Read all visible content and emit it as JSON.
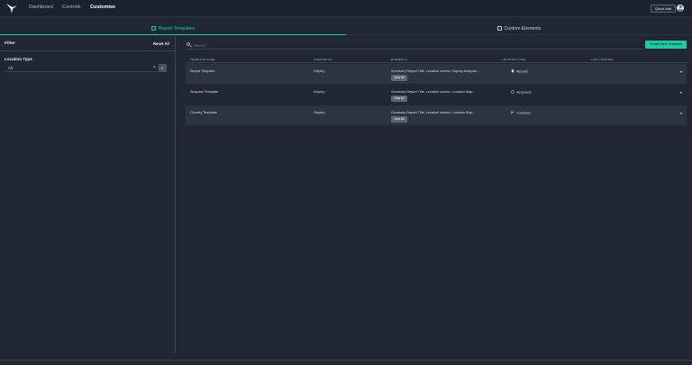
{
  "nav": {
    "items": [
      {
        "label": "Dashboard",
        "active": false
      },
      {
        "label": "Controls",
        "active": false
      },
      {
        "label": "Customise",
        "active": true
      }
    ],
    "quick_add_label": "Quick Add",
    "logo_icon": "bird-logo-icon",
    "avatar_icon": "user-avatar-icon"
  },
  "tabs": [
    {
      "label": "Report Templates",
      "active": true,
      "icon": "template-icon"
    },
    {
      "label": "Custom Elements",
      "active": false,
      "icon": "grid-icon"
    }
  ],
  "filter": {
    "title": "Filter",
    "reset_label": "Reset All",
    "location_type_label": "Location Type",
    "location_type_value": "All"
  },
  "search": {
    "placeholder": "Search...",
    "value": ""
  },
  "create_button_label": "Create New Template",
  "table": {
    "columns": [
      "Template Name",
      "Created By",
      "Elements",
      "Location Type",
      "Last Updated"
    ],
    "rows": [
      {
        "name": "Airport Template",
        "created_by": "Osprey",
        "elements": "Summary Report Title, Location scores, Osprey Analysis...",
        "view_label": "View All",
        "location_type": "Airports",
        "location_icon": "pin-icon",
        "last_updated": ""
      },
      {
        "name": "Airspace Template",
        "created_by": "Osprey",
        "elements": "Summary Report Title, Location scores, Location Map...",
        "view_label": "View All",
        "location_type": "Airspaces",
        "location_icon": "circle-icon",
        "last_updated": ""
      },
      {
        "name": "Country Template",
        "created_by": "Osprey",
        "elements": "Summary Report Title, Location scores, Location Map...",
        "view_label": "View All",
        "location_type": "Countries",
        "location_icon": "flag-icon",
        "last_updated": ""
      }
    ]
  },
  "colors": {
    "accent": "#22c7a3",
    "background": "#202733",
    "topbar": "#1c222d",
    "row_shade": "#2c3442"
  }
}
